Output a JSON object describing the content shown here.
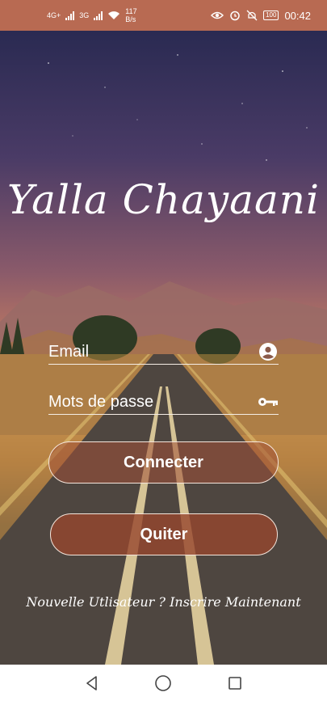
{
  "status_bar": {
    "network_1": "4G+",
    "network_2": "3G",
    "net_speed_value": "117",
    "net_speed_unit": "B/s",
    "battery": "100",
    "time": "00:42"
  },
  "app": {
    "title": "Yalla Chayaani",
    "email_placeholder": "Email",
    "password_placeholder": "Mots de passe",
    "connect_label": "Connecter",
    "quit_label": "Quiter",
    "signup_link": "Nouvelle Utlisateur ? Inscrire Maintenant"
  },
  "icons": {
    "email_field": "account-circle-icon",
    "password_field": "key-icon",
    "nav_back": "back-triangle-icon",
    "nav_home": "home-circle-icon",
    "nav_recents": "recents-square-icon"
  },
  "colors": {
    "status_bar": "#b86a52",
    "button_fill": "#a05037"
  }
}
